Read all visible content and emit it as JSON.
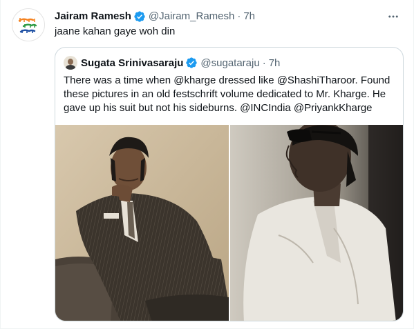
{
  "tweet": {
    "author_name": "Jairam Ramesh",
    "author_handle": "@Jairam_Ramesh",
    "separator": "·",
    "time": "7h",
    "text": "jaane kahan gaye woh din",
    "avatar": {
      "icon": "bharat-jodo-yatra-logo",
      "colors": {
        "saffron": "#f58220",
        "green": "#2e9a45",
        "blue": "#1d4fa3"
      }
    }
  },
  "quoted_tweet": {
    "author_name": "Sugata Srinivasaraju",
    "author_handle": "@sugataraju",
    "separator": "·",
    "time": "7h",
    "text_lines": [
      "There was a time when @kharge dressed like @ShashiTharoor. Found",
      "these pictures in an old festschrift volume dedicated to Mr. Kharge. He",
      "gave up his suit but not his sideburns. @INCIndia @PriyankKharge"
    ],
    "photos": [
      {
        "description": "sepia photo of man in pinstripe suit seated in armchair, chin on hand"
      },
      {
        "description": "black and white photo of man in sunglasses and light shirt, side profile"
      }
    ]
  },
  "icons": {
    "verified": "verified-badge-icon",
    "more": "more-options-icon"
  },
  "colors": {
    "text_primary": "#0f1419",
    "text_secondary": "#536471",
    "verified_blue": "#1d9bf0",
    "border": "#cfd9de"
  }
}
